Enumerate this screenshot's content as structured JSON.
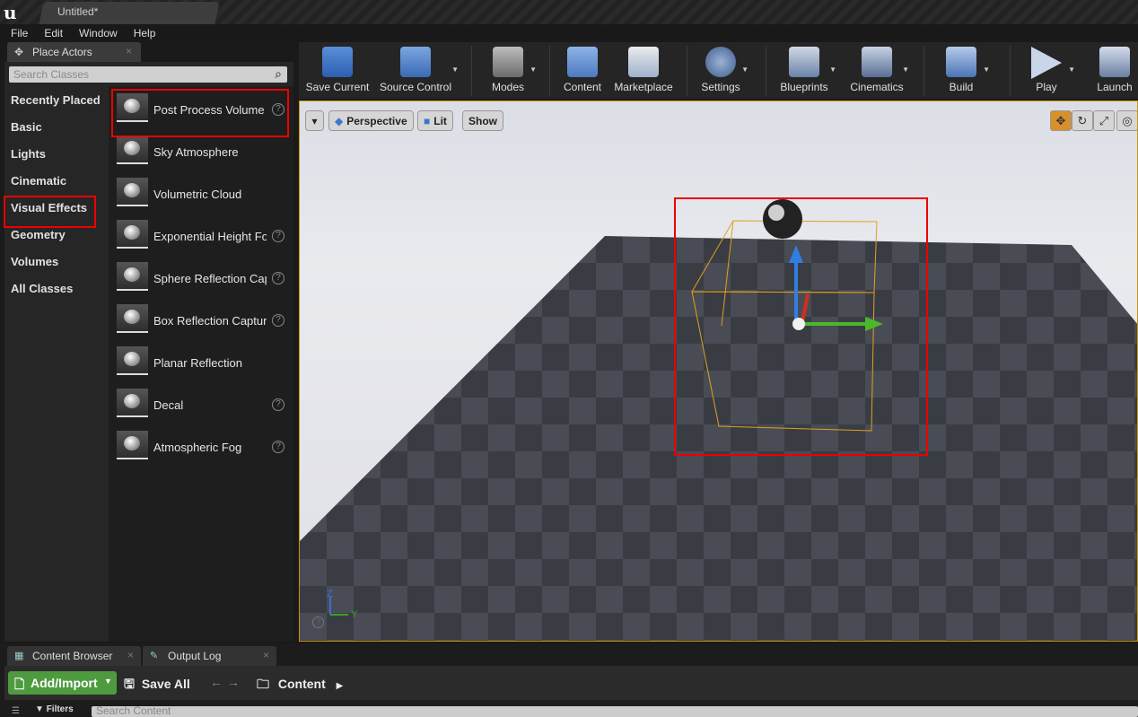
{
  "window": {
    "tab_title": "Untitled*"
  },
  "menu": [
    "File",
    "Edit",
    "Window",
    "Help"
  ],
  "place_actors": {
    "tab_label": "Place Actors",
    "search_placeholder": "Search Classes",
    "categories": [
      "Recently Placed",
      "Basic",
      "Lights",
      "Cinematic",
      "Visual Effects",
      "Geometry",
      "Volumes",
      "All Classes"
    ],
    "selected_category": "Visual Effects",
    "items": [
      {
        "name": "Post Process Volume",
        "help": true
      },
      {
        "name": "Sky Atmosphere",
        "help": false
      },
      {
        "name": "Volumetric Cloud",
        "help": false
      },
      {
        "name": "Exponential Height Fog",
        "help": true
      },
      {
        "name": "Sphere Reflection Capture",
        "help": true
      },
      {
        "name": "Box Reflection Capture",
        "help": true
      },
      {
        "name": "Planar Reflection",
        "help": false
      },
      {
        "name": "Decal",
        "help": true
      },
      {
        "name": "Atmospheric Fog",
        "help": true
      }
    ]
  },
  "toolbar": {
    "save_current": "Save Current",
    "source_control": "Source Control",
    "modes": "Modes",
    "content": "Content",
    "marketplace": "Marketplace",
    "settings": "Settings",
    "blueprints": "Blueprints",
    "cinematics": "Cinematics",
    "build": "Build",
    "play": "Play",
    "launch": "Launch"
  },
  "viewport": {
    "perspective": "Perspective",
    "lit": "Lit",
    "show": "Show",
    "axis_z": "Z",
    "axis_y": "Y"
  },
  "bottom": {
    "content_browser_tab": "Content Browser",
    "output_log_tab": "Output Log",
    "add_import": "Add/Import",
    "save_all": "Save All",
    "path": "Content",
    "filters": "Filters",
    "search_placeholder": "Search Content"
  }
}
